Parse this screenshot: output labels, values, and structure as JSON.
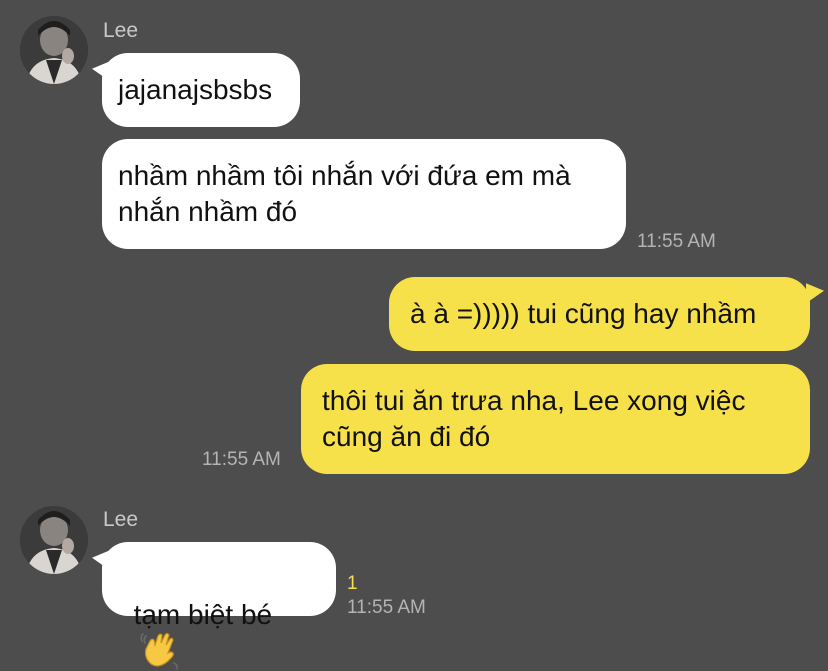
{
  "theme": {
    "background": "#4d4d4d",
    "incoming_bubble": "#ffffff",
    "outgoing_bubble": "#f6e14b",
    "timestamp_color": "#b4b4b4",
    "unread_color": "#f6e14b"
  },
  "messages": {
    "group1": {
      "sender": "Lee",
      "avatar_icon": "profile-photo",
      "bubble1": "jajanajsbsbs",
      "bubble2": "nhầm nhầm tôi nhắn với đứa em mà\nnhắn nhầm đó",
      "time": "11:55 AM"
    },
    "group2": {
      "bubble1": "à à =))))) tui cũng hay nhầm",
      "bubble2": "thôi tui ăn trưa nha, Lee xong việc\ncũng ăn đi đó",
      "time": "11:55 AM"
    },
    "group3": {
      "sender": "Lee",
      "avatar_icon": "profile-photo",
      "bubble1": "tạm biệt bé",
      "emoji_icon": "waving-hand-icon",
      "unread_count": "1",
      "time": "11:55 AM"
    }
  }
}
